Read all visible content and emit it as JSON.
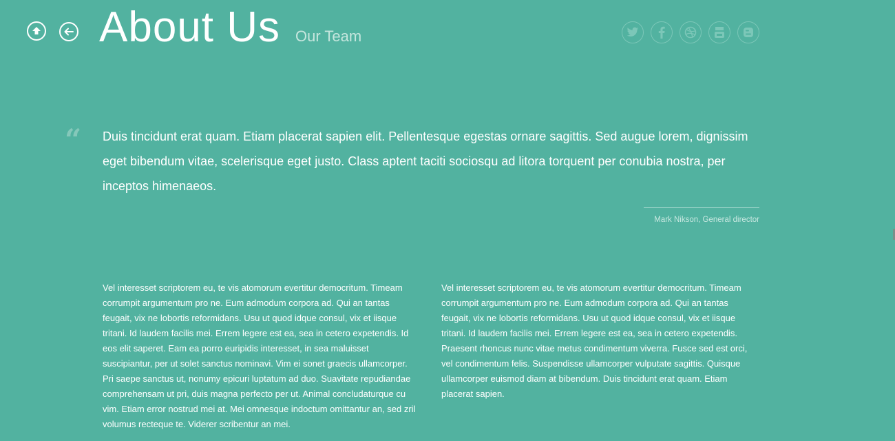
{
  "header": {
    "title": "About Us",
    "subtitle": "Our Team"
  },
  "nav": {
    "home_icon": "home-arrow-up-icon",
    "back_icon": "arrow-left-icon"
  },
  "social": [
    {
      "name": "twitter",
      "icon": "twitter-icon"
    },
    {
      "name": "facebook",
      "icon": "facebook-icon"
    },
    {
      "name": "dribbble",
      "icon": "dribbble-icon"
    },
    {
      "name": "youtube",
      "icon": "youtube-icon"
    },
    {
      "name": "blogger",
      "icon": "blogger-icon"
    }
  ],
  "quote": {
    "mark": "“",
    "text": "Duis tincidunt erat quam. Etiam placerat sapien elit. Pellentesque egestas ornare sagittis. Sed augue lorem, dignissim eget bibendum vitae, scelerisque eget justo. Class aptent taciti sociosqu ad litora torquent per conubia nostra, per inceptos himenaeos.",
    "author": "Mark Nikson, General director"
  },
  "columns": {
    "left": "Vel interesset scriptorem eu, te vis atomorum evertitur democritum. Timeam corrumpit argumentum pro ne. Eum admodum corpora ad. Qui an tantas feugait, vix ne lobortis reformidans. Usu ut quod idque consul, vix et iisque tritani. Id laudem facilis mei. Errem legere est ea, sea in cetero expetendis. Id eos elit saperet. Eam ea porro euripidis interesset, in sea maluisset suscipiantur, per ut solet sanctus nominavi. Vim ei sonet graecis ullamcorper. Pri saepe sanctus ut, nonumy epicuri luptatum ad duo. Suavitate repudiandae comprehensam ut pri, duis magna perfecto per ut. Animal concludaturque cu vim. Etiam error nostrud mei at. Mei omnesque indoctum omittantur an, sed zril volumus recteque te. Viderer scribentur an mei.",
    "right": "Vel interesset scriptorem eu, te vis atomorum evertitur democritum. Timeam corrumpit argumentum pro ne. Eum admodum corpora ad. Qui an tantas feugait, vix ne lobortis reformidans. Usu ut quod idque consul, vix et iisque tritani. Id laudem facilis mei. Errem legere est ea, sea in cetero expetendis. Praesent rhoncus nunc vitae metus condimentum viverra. Fusce sed est orci, vel condimentum felis. Suspendisse ullamcorper vulputate sagittis. Quisque ullamcorper euismod diam at bibendum. Duis tincidunt erat quam. Etiam placerat sapien."
  },
  "colors": {
    "background": "#52b2a0",
    "text": "#ffffff",
    "muted": "#c6e6de",
    "social_ring": "#7cc7b8"
  }
}
